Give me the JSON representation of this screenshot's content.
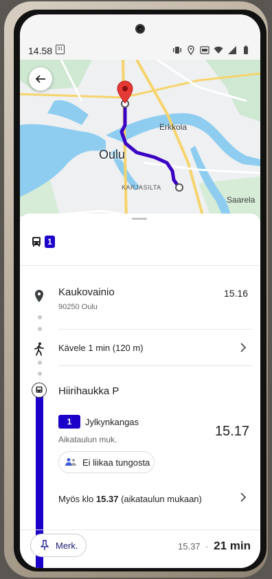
{
  "status_bar": {
    "time": "14.58",
    "calendar_day": "31"
  },
  "map": {
    "labels": {
      "oulu": "Oulu",
      "erkkola": "Erkkola",
      "karjasilta": "KARJASILTA",
      "saarela": "Saarela"
    },
    "route_color": "#3a00c4",
    "destination_pin_color": "#e53935"
  },
  "sheet": {
    "route_summary": {
      "line": "1"
    },
    "origin": {
      "name": "Kaukovainio",
      "address": "90250 Oulu",
      "time": "15.16"
    },
    "walk": {
      "label": "Kävele 1 min (120 m)"
    },
    "bus_stop": {
      "name": "Hiirihaukka P",
      "line": "1",
      "destination": "Jylkynkangas",
      "schedule_note": "Aikataulun muk.",
      "departure_time": "15.17",
      "crowding": "Ei liikaa tungosta",
      "also_prefix": "Myös klo ",
      "also_time": "15.37",
      "also_suffix": " (aikataulun mukaan)"
    }
  },
  "footer": {
    "save_button": "Merk.",
    "arrival_time": "15.37",
    "separator": "·",
    "duration": "21 min"
  },
  "colors": {
    "accent": "#1a00c8",
    "water": "#8ec9ef",
    "park": "#c6e7c9"
  }
}
